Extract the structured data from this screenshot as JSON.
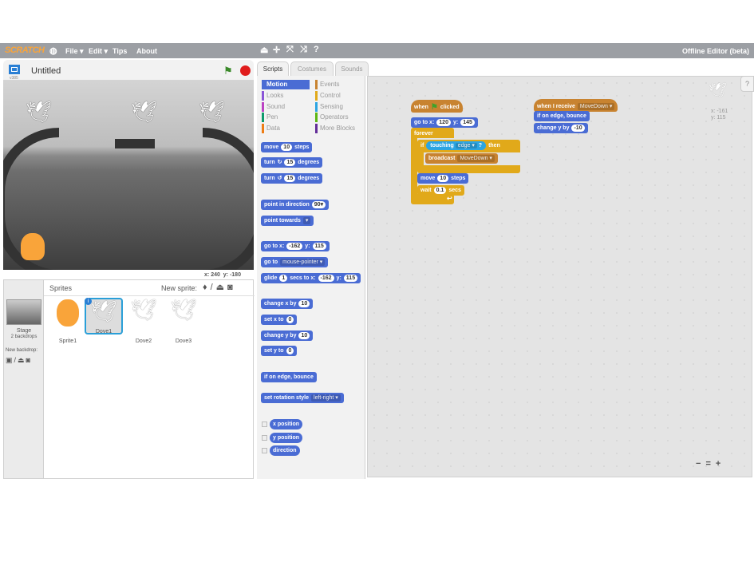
{
  "menubar": {
    "logo": "SCRATCH",
    "file": "File ▾",
    "edit": "Edit ▾",
    "tips": "Tips",
    "about": "About",
    "edition": "Offline Editor (beta)"
  },
  "stage": {
    "title": "Untitled",
    "version": "v385",
    "x_label": "x:",
    "x": "240",
    "y_label": "y:",
    "y": "-180"
  },
  "sprites": {
    "header": "Sprites",
    "new_sprite": "New sprite:",
    "stage_label": "Stage",
    "backdrops": "2 backdrops",
    "new_backdrop": "New backdrop:",
    "items": [
      {
        "name": "Sprite1"
      },
      {
        "name": "Dove1",
        "selected": true
      },
      {
        "name": "Dove2"
      },
      {
        "name": "Dove3"
      }
    ]
  },
  "tabs": [
    "Scripts",
    "Costumes",
    "Sounds"
  ],
  "categories": [
    {
      "label": "Motion",
      "color": "#4a6cd4"
    },
    {
      "label": "Looks",
      "color": "#8a55d7"
    },
    {
      "label": "Sound",
      "color": "#bb42c3"
    },
    {
      "label": "Pen",
      "color": "#0e9a6c"
    },
    {
      "label": "Data",
      "color": "#ee7d16"
    },
    {
      "label": "Events",
      "color": "#c88330"
    },
    {
      "label": "Control",
      "color": "#e1a91a"
    },
    {
      "label": "Sensing",
      "color": "#2ca5e2"
    },
    {
      "label": "Operators",
      "color": "#5cb712"
    },
    {
      "label": "More Blocks",
      "color": "#632d99"
    }
  ],
  "palette": {
    "move": [
      "move",
      "10",
      "steps"
    ],
    "turn_r": [
      "turn",
      "↻",
      "15",
      "degrees"
    ],
    "turn_l": [
      "turn",
      "↺",
      "15",
      "degrees"
    ],
    "point_dir": [
      "point in direction",
      "90▾"
    ],
    "point_towards": [
      "point towards",
      "▾"
    ],
    "goto_xy": [
      "go to x:",
      "-162",
      "y:",
      "115"
    ],
    "goto": [
      "go to",
      "mouse-pointer ▾"
    ],
    "glide": [
      "glide",
      "1",
      "secs to x:",
      "-162",
      "y:",
      "115"
    ],
    "change_x": [
      "change x by",
      "10"
    ],
    "set_x": [
      "set x to",
      "0"
    ],
    "change_y": [
      "change y by",
      "10"
    ],
    "set_y": [
      "set y to",
      "0"
    ],
    "bounce": "if on edge, bounce",
    "rot": [
      "set rotation style",
      "left-right ▾"
    ],
    "reporters": [
      "x position",
      "y position",
      "direction"
    ]
  },
  "script1": {
    "hat": [
      "when",
      "clicked"
    ],
    "goto": [
      "go to x:",
      "120",
      "y:",
      "145"
    ],
    "forever": "forever",
    "if": [
      "if",
      "touching",
      "edge ▾",
      "?",
      "then"
    ],
    "broadcast": [
      "broadcast",
      "MoveDown ▾"
    ],
    "move": [
      "move",
      "10",
      "steps"
    ],
    "wait": [
      "wait",
      "0.1",
      "secs"
    ],
    "loop_arrow": "↩"
  },
  "script2": {
    "hat": [
      "when I receive",
      "MoveDown ▾"
    ],
    "bounce": "if on edge, bounce",
    "change_y": [
      "change y by",
      "-10"
    ]
  },
  "sprite_info": {
    "x": "x: -161",
    "y": "y: 115"
  },
  "zoom": {
    "out": "−",
    "reset": "=",
    "in": "+"
  }
}
